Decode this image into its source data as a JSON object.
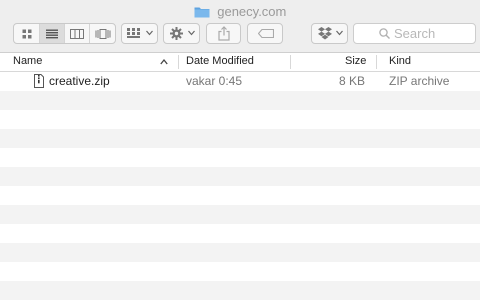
{
  "window": {
    "title": "genecy.com"
  },
  "toolbar": {
    "view_buttons": [
      "icon-view-icon",
      "list-view-icon",
      "column-view-icon",
      "cover-flow-icon"
    ],
    "arrange_icon": "arrange-icon",
    "action_icon": "gear-icon",
    "share_icon": "share-icon",
    "tags_icon": "tag-icon",
    "dropbox_icon": "dropbox-icon",
    "search_placeholder": "Search"
  },
  "columns": {
    "name": "Name",
    "date": "Date Modified",
    "size": "Size",
    "kind": "Kind"
  },
  "files": [
    {
      "name": "creative.zip",
      "date": "vakar 0:45",
      "size": "8 KB",
      "kind": "ZIP archive"
    }
  ],
  "colors": {
    "chrome": "#eeeeee",
    "alt_row": "#f3f3f3",
    "folder": "#5ea3e0"
  }
}
